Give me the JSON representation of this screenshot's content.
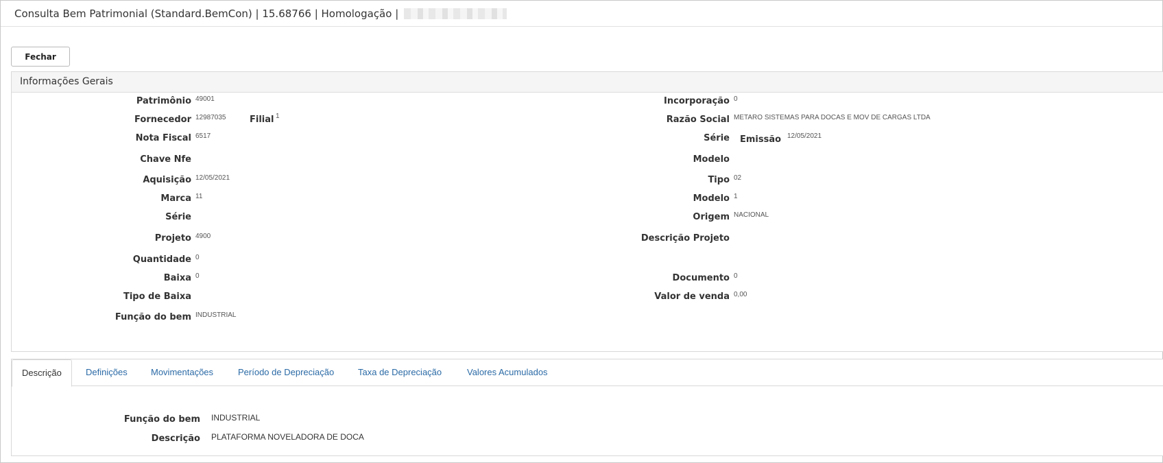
{
  "window": {
    "title": "Consulta Bem Patrimonial (Standard.BemCon) | 15.68766 | Homologação |"
  },
  "toolbar": {
    "close_label": "Fechar"
  },
  "general": {
    "header": "Informações Gerais",
    "left": {
      "patrimonio": {
        "label": "Patrimônio",
        "value": "49001"
      },
      "fornecedor": {
        "label": "Fornecedor",
        "value": "12987035"
      },
      "filial": {
        "label": "Filial",
        "value": "1"
      },
      "nota_fiscal": {
        "label": "Nota Fiscal",
        "value": "6517"
      },
      "chave_nfe": {
        "label": "Chave Nfe",
        "value": ""
      },
      "aquisicao": {
        "label": "Aquisição",
        "value": "12/05/2021"
      },
      "marca": {
        "label": "Marca",
        "value": "11"
      },
      "serie": {
        "label": "Série",
        "value": ""
      },
      "projeto": {
        "label": "Projeto",
        "value": "4900"
      },
      "quantidade": {
        "label": "Quantidade",
        "value": "0"
      },
      "baixa": {
        "label": "Baixa",
        "value": "0"
      },
      "tipo_baixa": {
        "label": "Tipo de Baixa",
        "value": ""
      },
      "funcao_bem": {
        "label": "Função do bem",
        "value": "INDUSTRIAL"
      }
    },
    "right": {
      "incorporacao": {
        "label": "Incorporação",
        "value": "0"
      },
      "razao_social": {
        "label": "Razão Social",
        "value": "METARO SISTEMAS PARA DOCAS E MOV DE CARGAS LTDA"
      },
      "serie": {
        "label": "Série",
        "value": ""
      },
      "emissao": {
        "label": "Emissão",
        "value": "12/05/2021"
      },
      "modelo_nf": {
        "label": "Modelo",
        "value": ""
      },
      "tipo": {
        "label": "Tipo",
        "value": "02"
      },
      "modelo": {
        "label": "Modelo",
        "value": "1"
      },
      "origem": {
        "label": "Origem",
        "value": "NACIONAL"
      },
      "descricao_projeto": {
        "label": "Descrição Projeto",
        "value": ""
      },
      "documento": {
        "label": "Documento",
        "value": "0"
      },
      "valor_venda": {
        "label": "Valor de venda",
        "value": "0,00"
      }
    }
  },
  "tabs": [
    {
      "label": "Descrição",
      "active": true
    },
    {
      "label": "Definições",
      "active": false
    },
    {
      "label": "Movimentações",
      "active": false
    },
    {
      "label": "Período de Depreciação",
      "active": false
    },
    {
      "label": "Taxa de Depreciação",
      "active": false
    },
    {
      "label": "Valores Acumulados",
      "active": false
    }
  ],
  "description_tab": {
    "funcao_bem": {
      "label": "Função do bem",
      "value": "INDUSTRIAL"
    },
    "descricao": {
      "label": "Descrição",
      "value": "PLATAFORMA NOVELADORA DE DOCA"
    }
  }
}
